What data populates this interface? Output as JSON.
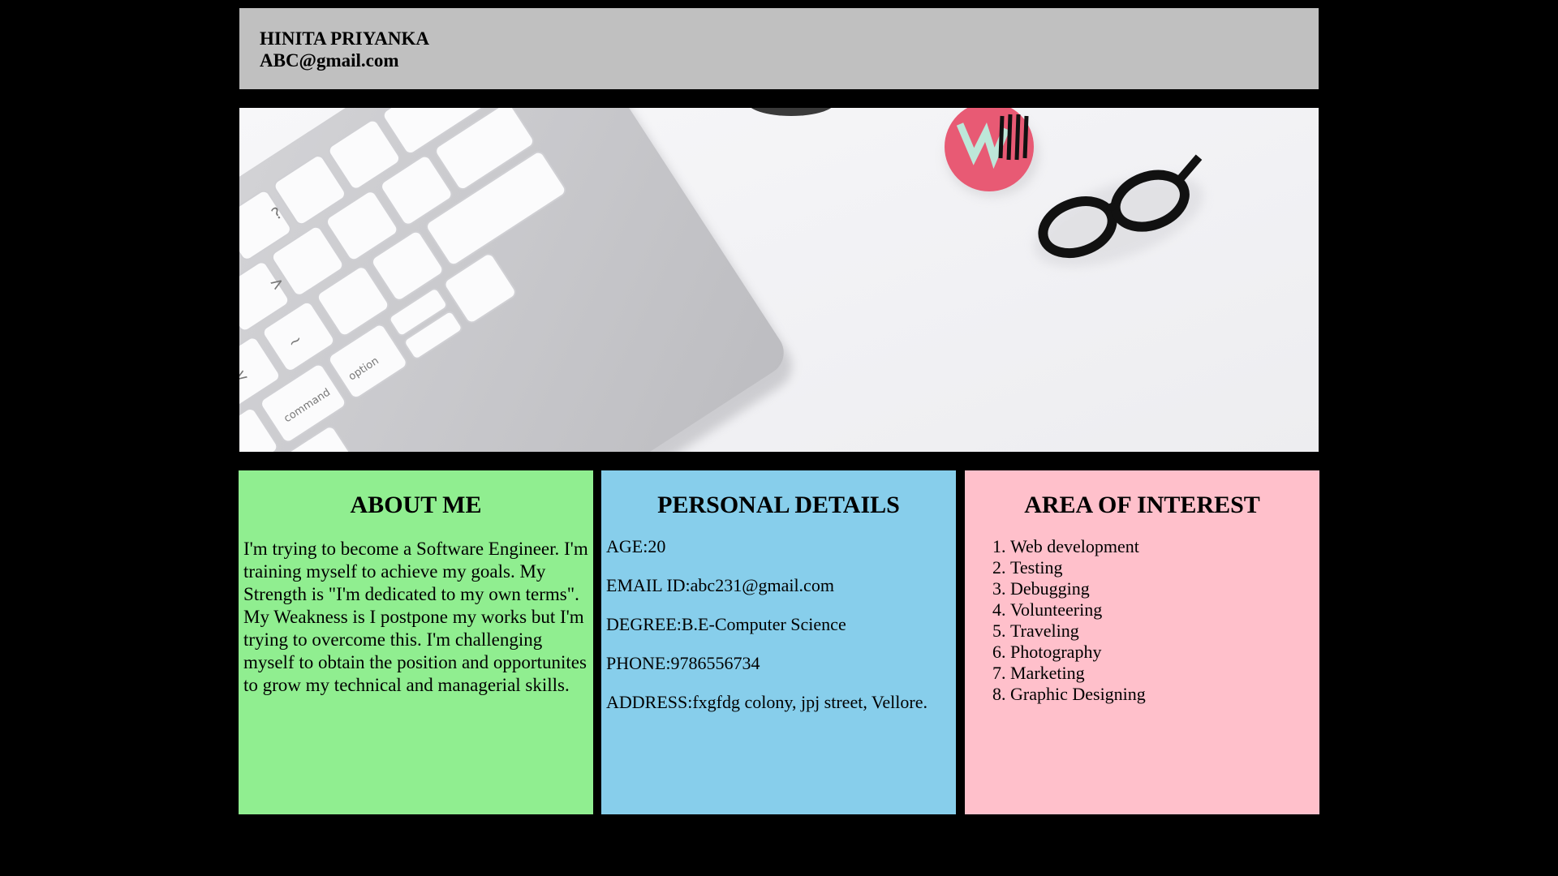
{
  "header": {
    "name": "HINITA PRIYANKA",
    "email": "ABC@gmail.com"
  },
  "about": {
    "title": "ABOUT ME",
    "text": "I'm trying to become a Software Engineer. I'm training myself to achieve my goals. My Strength is \"I'm dedicated to my own terms\". My Weakness is I postpone my works but I'm trying to overcome this. I'm challenging myself to obtain the position and opportunites to grow my technical and managerial skills."
  },
  "details": {
    "title": "PERSONAL DETAILS",
    "rows": [
      "AGE:20",
      "EMAIL ID:abc231@gmail.com",
      "DEGREE:B.E-Computer Science",
      "PHONE:9786556734",
      "ADDRESS:fxgfdg colony, jpj street, Vellore."
    ]
  },
  "interest": {
    "title": "AREA OF INTEREST",
    "items": [
      "Web development",
      "Testing",
      "Debugging",
      "Volunteering",
      "Traveling",
      "Photography",
      "Marketing",
      "Graphic Designing"
    ]
  },
  "colors": {
    "background": "#000000",
    "header": "#c0c0c0",
    "about": "#90ee90",
    "details": "#87ceeb",
    "interest": "#ffc0cb"
  }
}
